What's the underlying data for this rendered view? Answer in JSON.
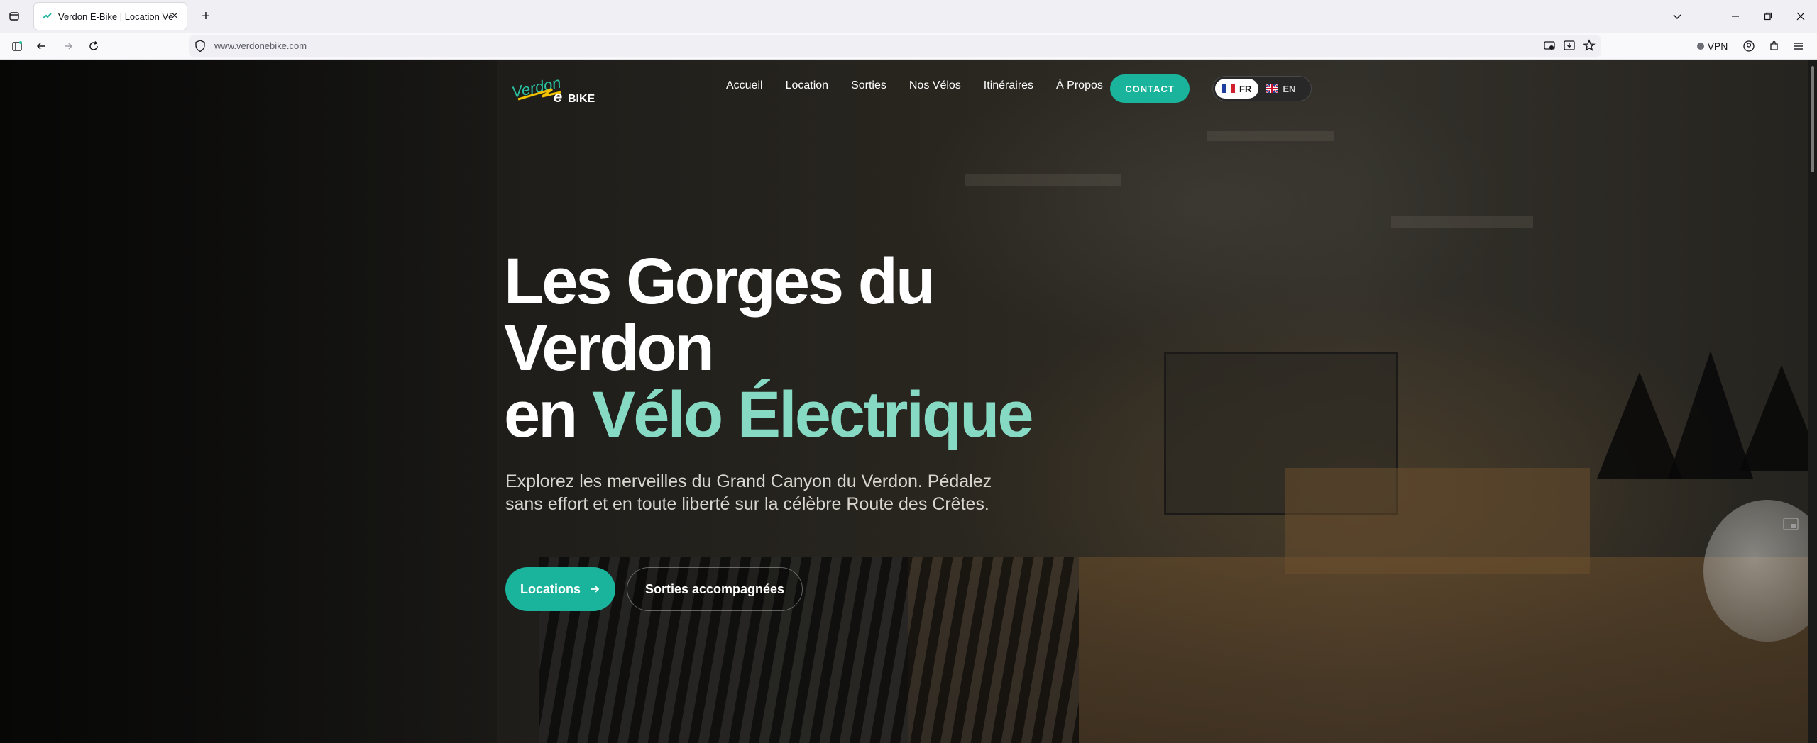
{
  "browser": {
    "tab_title": "Verdon E-Bike | Location Vélos Électriques",
    "url": "www.verdonebike.com",
    "vpn_label": "VPN"
  },
  "site": {
    "logo_text_top": "Verdon",
    "logo_text_e": "e",
    "logo_text_bike": "BIKE",
    "nav": [
      "Accueil",
      "Location",
      "Sorties",
      "Nos Vélos",
      "Itinéraires",
      "À Propos"
    ],
    "contact_label": "CONTACT",
    "lang": {
      "fr": "FR",
      "en": "EN",
      "active": "FR"
    }
  },
  "hero": {
    "title_line1": "Les Gorges du",
    "title_line2": "Verdon",
    "title_line3_prefix": "en ",
    "title_line3_accent": "Vélo Électrique",
    "subtitle": "Explorez les merveilles du Grand Canyon du Verdon. Pédalez sans effort et en toute liberté sur la célèbre Route des Crêtes.",
    "primary_cta": "Locations",
    "secondary_cta": "Sorties accompagnées"
  },
  "colors": {
    "accent": "#1ab39b",
    "title_accent": "#86d9c3"
  }
}
